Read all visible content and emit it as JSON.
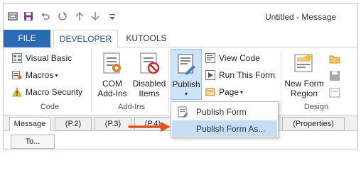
{
  "window": {
    "title": "Untitled - Message"
  },
  "quick_access": [
    {
      "name": "app-icon"
    },
    {
      "name": "save-icon"
    },
    {
      "name": "undo-icon"
    },
    {
      "name": "redo-icon"
    },
    {
      "name": "up-arrow-icon"
    },
    {
      "name": "down-arrow-icon"
    },
    {
      "name": "customize-qat-icon"
    }
  ],
  "tabs": {
    "file": "FILE",
    "developer": "DEVELOPER",
    "kutools": "KUTOOLS"
  },
  "ribbon": {
    "code": {
      "label": "Code",
      "visual_basic": "Visual Basic",
      "macros": "Macros",
      "macro_security": "Macro Security"
    },
    "addins": {
      "label": "Add-Ins",
      "com_line1": "COM",
      "com_line2": "Add-Ins",
      "disabled_line1": "Disabled",
      "disabled_line2": "Items"
    },
    "form": {
      "publish": "Publish",
      "view_code": "View Code",
      "run_this_form": "Run This Form",
      "page": "Page"
    },
    "design": {
      "label": "Design",
      "new_form_line1": "New Form",
      "new_form_line2": "Region"
    }
  },
  "form_tabs": [
    "Message",
    "(P.2)",
    "(P.3)",
    "(P.4)",
    "(Properties)"
  ],
  "to_button": "To...",
  "publish_menu": {
    "items": [
      "Publish Form",
      "Publish Form As..."
    ]
  },
  "colors": {
    "file_tab": "#2b6bb3",
    "highlight": "#c5def5",
    "arrow": "#e0531d"
  }
}
